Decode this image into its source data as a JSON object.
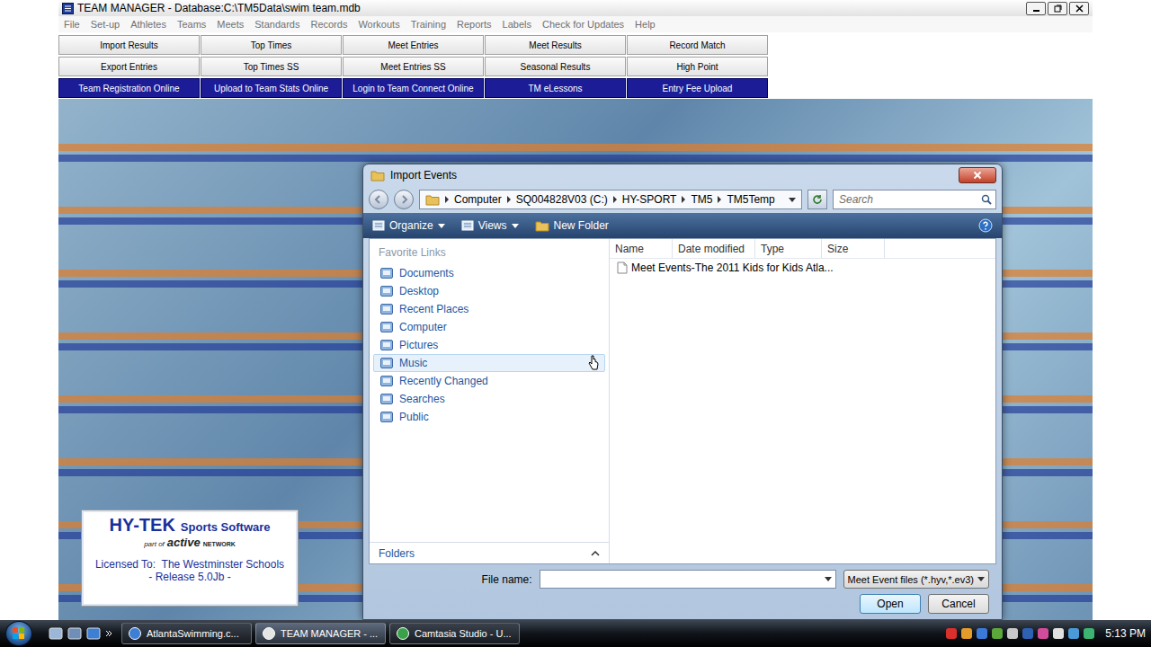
{
  "app_window": {
    "title": "TEAM MANAGER - Database:C:\\TM5Data\\swim team.mdb"
  },
  "menu": [
    "File",
    "Set-up",
    "Athletes",
    "Teams",
    "Meets",
    "Standards",
    "Records",
    "Workouts",
    "Training",
    "Reports",
    "Labels",
    "Check for Updates",
    "Help"
  ],
  "quick_buttons": [
    {
      "label": "Import Results",
      "kind": "standard"
    },
    {
      "label": "Top Times",
      "kind": "standard"
    },
    {
      "label": "Meet Entries",
      "kind": "standard"
    },
    {
      "label": "Meet Results",
      "kind": "standard"
    },
    {
      "label": "Record Match",
      "kind": "standard"
    },
    {
      "label": "Export Entries",
      "kind": "standard"
    },
    {
      "label": "Top Times SS",
      "kind": "standard"
    },
    {
      "label": "Meet Entries SS",
      "kind": "standard"
    },
    {
      "label": "Seasonal Results",
      "kind": "standard"
    },
    {
      "label": "High Point",
      "kind": "standard"
    },
    {
      "label": "Team Registration Online",
      "kind": "online"
    },
    {
      "label": "Upload to Team Stats Online",
      "kind": "online"
    },
    {
      "label": "Login to Team Connect Online",
      "kind": "online"
    },
    {
      "label": "TM eLessons",
      "kind": "online"
    },
    {
      "label": "Entry Fee Upload",
      "kind": "online"
    }
  ],
  "dialog": {
    "title": "Import Events",
    "path": [
      "Computer",
      "SQ004828V03 (C:)",
      "HY-SPORT",
      "TM5",
      "TM5Temp"
    ],
    "search": {
      "placeholder": "Search"
    },
    "toolbar": [
      {
        "label": "Organize",
        "dropdown": true
      },
      {
        "label": "Views",
        "dropdown": true
      },
      {
        "label": "New Folder",
        "dropdown": false
      }
    ],
    "favorites_title": "Favorite Links",
    "favorites": [
      {
        "label": "Documents",
        "hovered": false
      },
      {
        "label": "Desktop",
        "hovered": false
      },
      {
        "label": "Recent Places",
        "hovered": false
      },
      {
        "label": "Computer",
        "hovered": false
      },
      {
        "label": "Pictures",
        "hovered": false
      },
      {
        "label": "Music",
        "hovered": true
      },
      {
        "label": "Recently Changed",
        "hovered": false
      },
      {
        "label": "Searches",
        "hovered": false
      },
      {
        "label": "Public",
        "hovered": false
      }
    ],
    "folders_label": "Folders",
    "columns": [
      "Name",
      "Date modified",
      "Type",
      "Size"
    ],
    "files": [
      {
        "name": "Meet Events-The 2011 Kids for Kids Atla..."
      }
    ],
    "file_name": {
      "label": "File name:",
      "value": ""
    },
    "file_type": "Meet Event files (*.hyv,*.ev3)",
    "buttons": [
      {
        "label": "Open",
        "default": true
      },
      {
        "label": "Cancel",
        "default": false
      }
    ]
  },
  "logo": {
    "brand": "HY-TEK",
    "product": "Sports Software",
    "part_of": "part of",
    "network_name": "active",
    "network_word": "NETWORK",
    "licensed": "Licensed To:  The Westminster Schools",
    "release": "- Release 5.0Jb -"
  },
  "taskbar": {
    "tasks": [
      {
        "label": "AtlantaSwimming.c...",
        "selected": false
      },
      {
        "label": "TEAM MANAGER - ...",
        "selected": true
      },
      {
        "label": "Camtasia Studio - U...",
        "selected": false
      }
    ],
    "clock": "5:13 PM"
  }
}
